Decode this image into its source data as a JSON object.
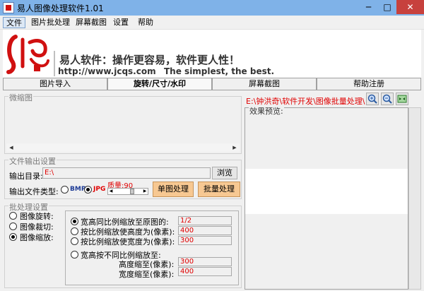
{
  "window": {
    "title": "易人图像处理软件1.01",
    "minimize": "─",
    "maximize": "□",
    "close": "✕"
  },
  "menu": [
    "文件",
    "图片批处理",
    "屏幕截图",
    "设置",
    "帮助"
  ],
  "banner": {
    "slogan": "易人软件：操作更容易，软件更人性！",
    "url": "http://www.jcqs.com",
    "tagline": "The simplest, the best."
  },
  "tabs": [
    "图片导入",
    "旋转/尺寸/水印",
    "屏幕截图",
    "帮助注册"
  ],
  "thumbnail": {
    "label": "微缩图"
  },
  "path_display": "E:\\钟洪奇\\软件开发\\图像批量处理\\",
  "preview": {
    "label": "效果预览:"
  },
  "output": {
    "label": "文件输出设置",
    "dir_label": "输出目录:",
    "dir_value": "E:\\",
    "browse_label": "浏览",
    "type_label": "输出文件类型:",
    "type_bmp": "BMP",
    "type_jpg": "JPG",
    "quality_label": "质量:90",
    "quality_value": 90,
    "single_button": "单图处理",
    "batch_button": "批量处理"
  },
  "batch": {
    "label": "批处理设置",
    "modes": [
      "图像旋转:",
      "图像裁切:",
      "图像缩放:"
    ],
    "selected_mode": 2,
    "options": [
      {
        "label": "宽高同比例缩放至原图的:",
        "value": "1/2"
      },
      {
        "label": "按比例缩放使高度为(像素):",
        "value": "400"
      },
      {
        "label": "按比例缩放使宽度为(像素):",
        "value": "300"
      },
      {
        "label": "宽高按不同比例缩放至:",
        "value": ""
      }
    ],
    "height_label": "高度缩至(像素):",
    "height_value": "300",
    "width_label": "宽度缩至(像素):",
    "width_value": "400"
  },
  "colors": {
    "accent": "#e00000",
    "titlebar": "#7fb2e8",
    "button_highlight": "#f7c892"
  },
  "icons": [
    "app-icon",
    "logo-icon",
    "zoom-in-icon",
    "zoom-out-icon",
    "fit-window-icon"
  ]
}
